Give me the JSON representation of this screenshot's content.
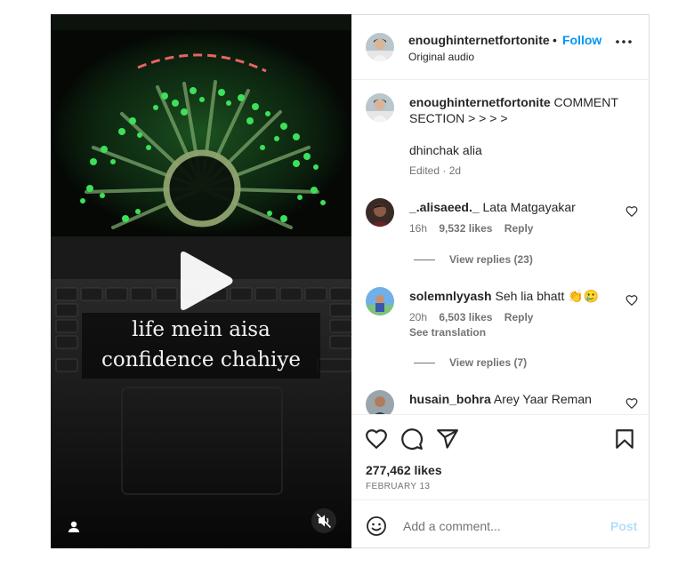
{
  "post": {
    "caption_line1": "life mein aisa",
    "caption_line2": "confidence chahiye",
    "header": {
      "username": "enoughinternetfortonite",
      "separator": "•",
      "follow_label": "Follow",
      "audio_label": "Original audio"
    },
    "author_comment": {
      "username": "enoughinternetfortonite",
      "text": "COMMENT SECTION > > > >",
      "text2": "dhinchak alia",
      "meta": "Edited · 2d"
    },
    "comments": [
      {
        "username": "_.alisaeed._",
        "text": "Lata Matgayakar",
        "time": "16h",
        "likes": "9,532 likes",
        "reply": "Reply",
        "view_replies": "View replies (23)"
      },
      {
        "username": "solemnlyyash",
        "text": "Seh lia bhatt 👏🥲",
        "time": "20h",
        "likes": "6,503 likes",
        "reply": "Reply",
        "see_translation": "See translation",
        "view_replies": "View replies (7)"
      },
      {
        "username": "husain_bohra",
        "text": "Arey Yaar Reman"
      }
    ],
    "likes_count": "277,462 likes",
    "date": "FEBRUARY 13",
    "add_comment_placeholder": "Add a comment...",
    "post_label": "Post"
  },
  "colors": {
    "accent": "#0095f6",
    "post_disabled": "#b2dffc",
    "muted_text": "#737373",
    "led_green": "#3de05a"
  },
  "icons": [
    "play-icon",
    "user-tag-icon",
    "muted-speaker-icon",
    "more-options-icon",
    "heart-icon",
    "comment-icon",
    "share-icon",
    "bookmark-icon",
    "emoji-icon"
  ]
}
